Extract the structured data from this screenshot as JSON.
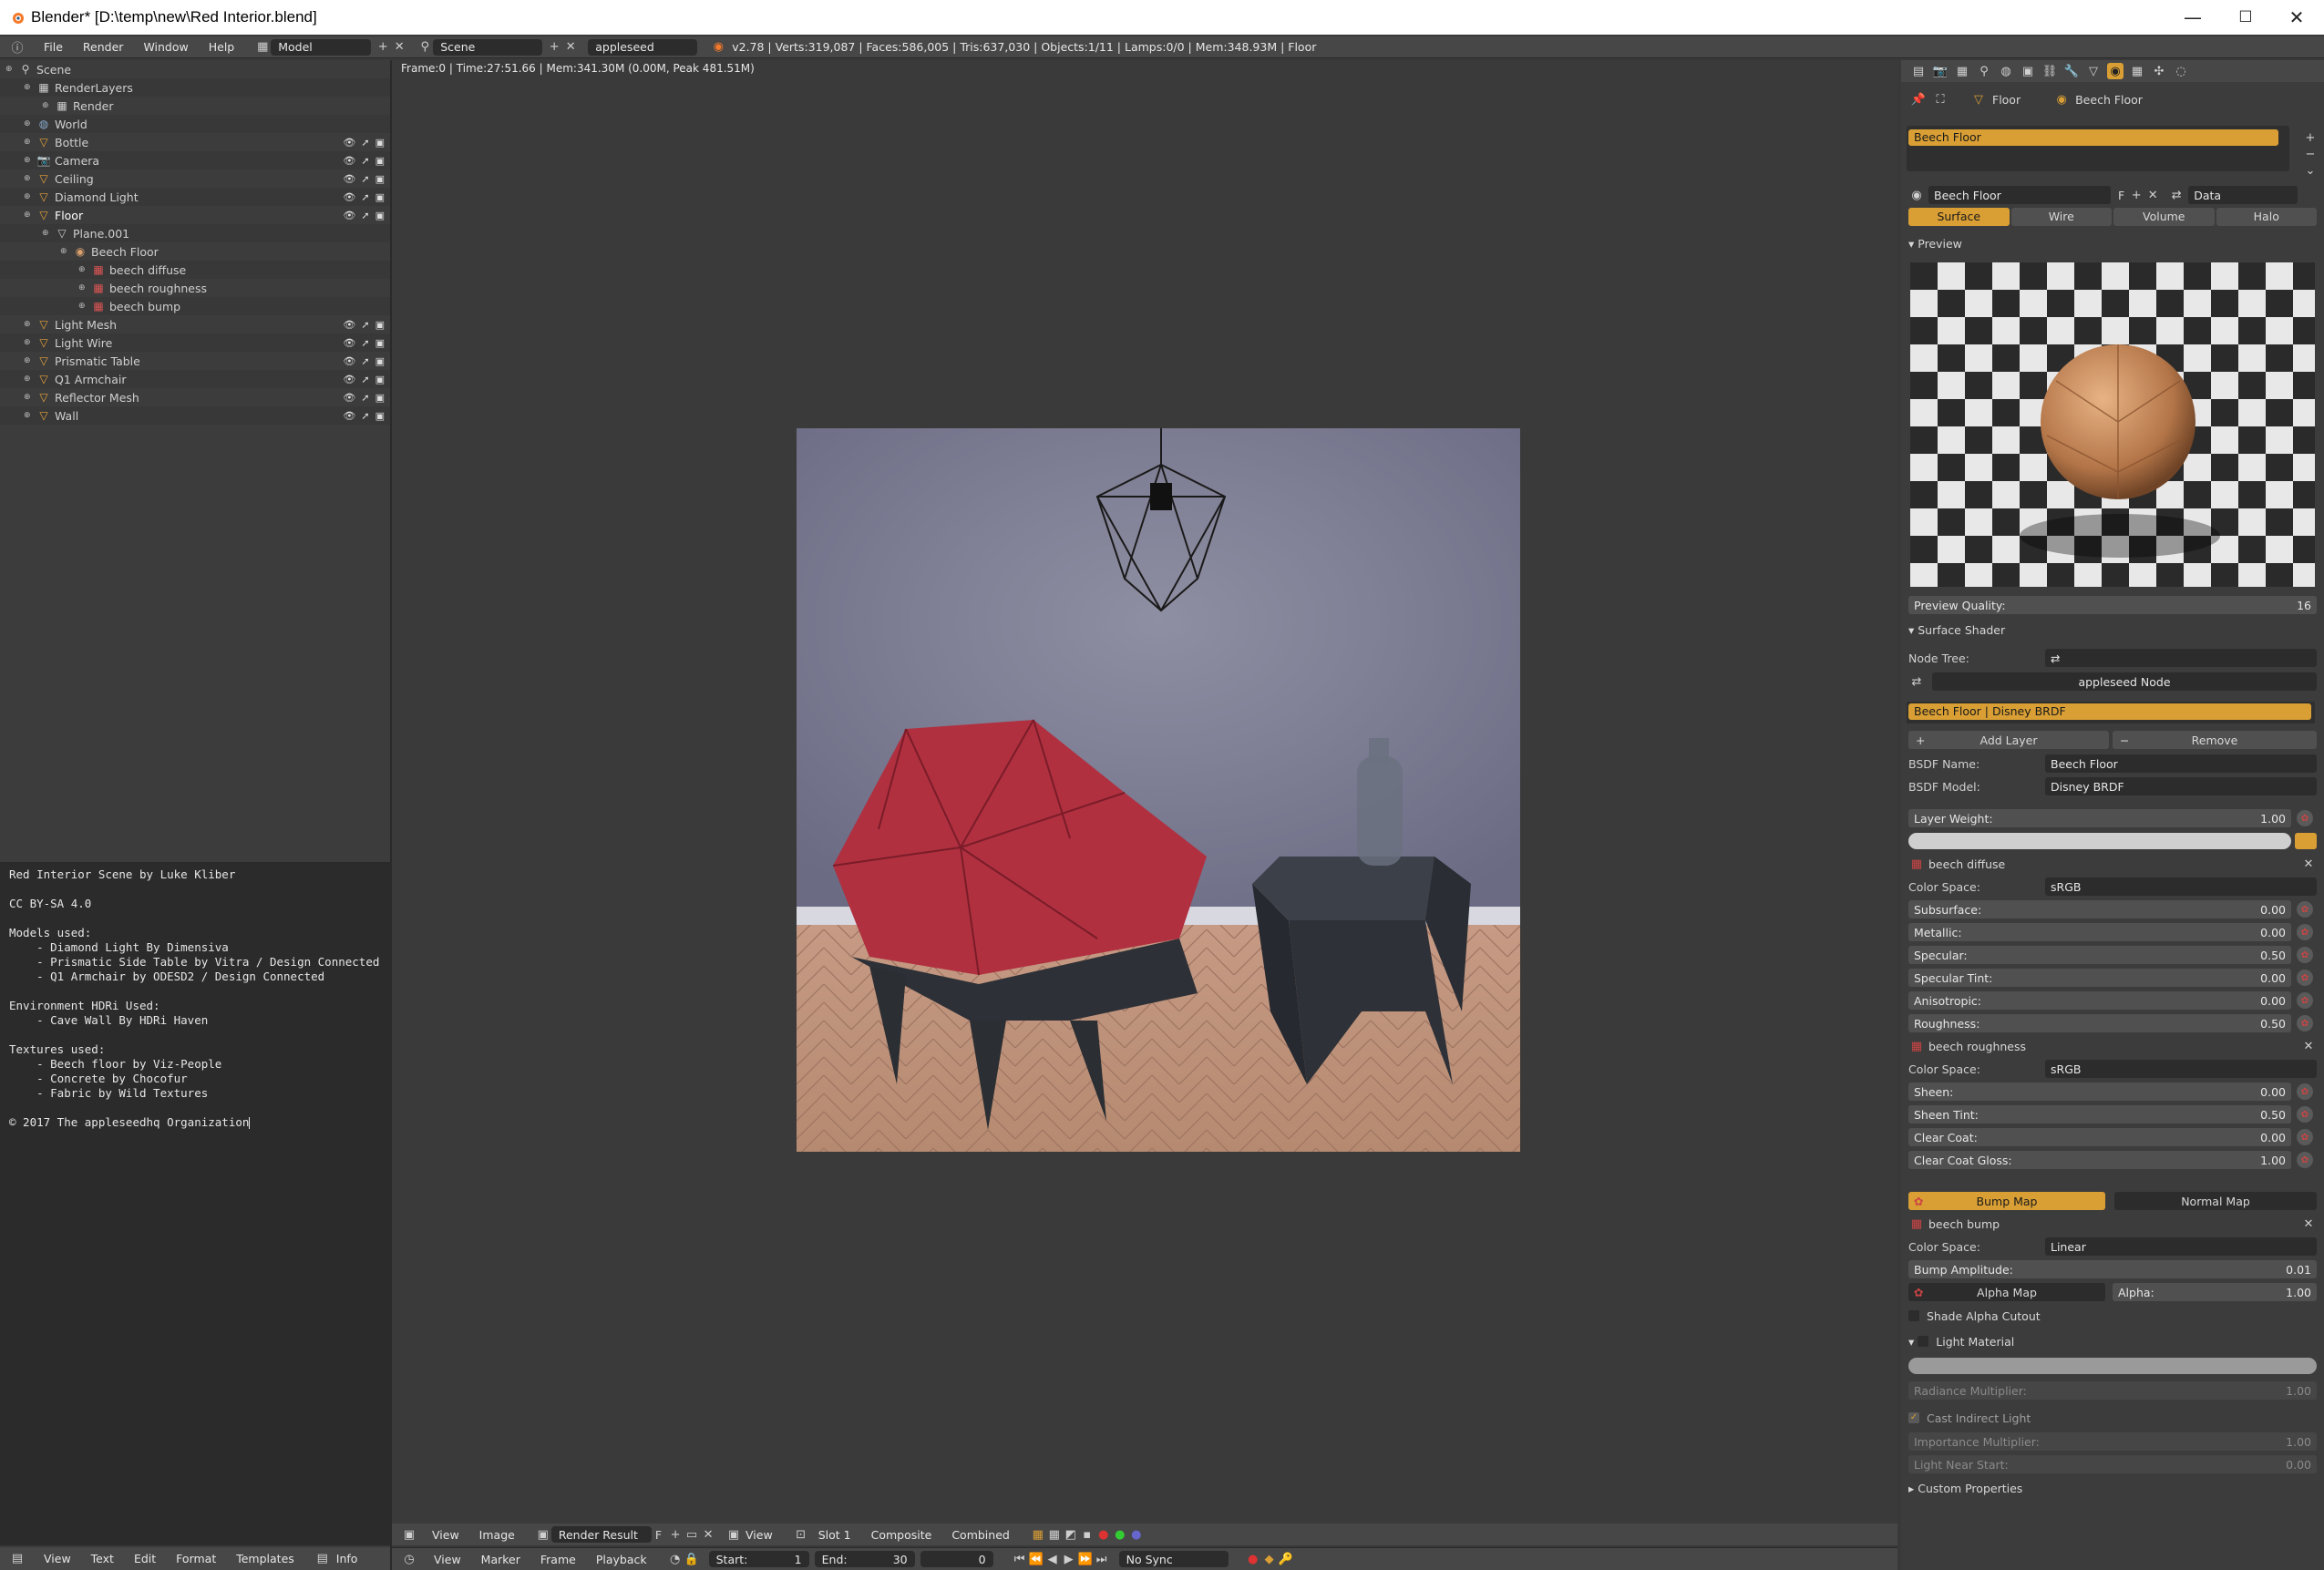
{
  "window": {
    "title": "Blender* [D:\\temp\\new\\Red Interior.blend]",
    "minimize": "—",
    "maximize": "☐",
    "close": "✕"
  },
  "info_header": {
    "menus": [
      "File",
      "Render",
      "Window",
      "Help"
    ],
    "screen_layout": "Model",
    "scene": "Scene",
    "render_engine": "appleseed",
    "stats": "v2.78 | Verts:319,087 | Faces:586,005 | Tris:637,030 | Objects:1/11 | Lamps:0/0 | Mem:348.93M | Floor"
  },
  "outliner": {
    "rows": [
      {
        "label": "Scene",
        "icon": "scene-icon",
        "indent": 0,
        "vis": false
      },
      {
        "label": "RenderLayers",
        "icon": "renderlayers-icon",
        "indent": 1,
        "vis": false
      },
      {
        "label": "Render",
        "icon": "renderlayer-icon",
        "indent": 2,
        "vis": false
      },
      {
        "label": "World",
        "icon": "world-icon",
        "indent": 1,
        "vis": false
      },
      {
        "label": "Bottle",
        "icon": "mesh-icon",
        "indent": 1,
        "vis": true
      },
      {
        "label": "Camera",
        "icon": "camera-icon",
        "indent": 1,
        "vis": true
      },
      {
        "label": "Ceiling",
        "icon": "mesh-icon",
        "indent": 1,
        "vis": true
      },
      {
        "label": "Diamond Light",
        "icon": "mesh-icon",
        "indent": 1,
        "vis": true
      },
      {
        "label": "Floor",
        "icon": "mesh-icon",
        "indent": 1,
        "vis": true,
        "selected": true
      },
      {
        "label": "Plane.001",
        "icon": "meshdata-icon",
        "indent": 2,
        "vis": false
      },
      {
        "label": "Beech Floor",
        "icon": "material-icon",
        "indent": 3,
        "vis": false
      },
      {
        "label": "beech diffuse",
        "icon": "texture-icon",
        "indent": 4,
        "vis": false
      },
      {
        "label": "beech roughness",
        "icon": "texture-icon",
        "indent": 4,
        "vis": false
      },
      {
        "label": "beech bump",
        "icon": "texture-icon",
        "indent": 4,
        "vis": false
      },
      {
        "label": "Light Mesh",
        "icon": "mesh-icon",
        "indent": 1,
        "vis": true
      },
      {
        "label": "Light Wire",
        "icon": "mesh-icon",
        "indent": 1,
        "vis": true
      },
      {
        "label": "Prismatic Table",
        "icon": "mesh-icon",
        "indent": 1,
        "vis": true
      },
      {
        "label": "Q1 Armchair",
        "icon": "mesh-icon",
        "indent": 1,
        "vis": true
      },
      {
        "label": "Reflector Mesh",
        "icon": "mesh-icon",
        "indent": 1,
        "vis": true
      },
      {
        "label": "Wall",
        "icon": "mesh-icon",
        "indent": 1,
        "vis": true
      }
    ]
  },
  "text_editor": {
    "content": "Red Interior Scene by Luke Kliber\n\nCC BY-SA 4.0\n\nModels used:\n    - Diamond Light By Dimensiva\n    - Prismatic Side Table by Vitra / Design Connected\n    - Q1 Armchair by ODESD2 / Design Connected\n\nEnvironment HDRi Used:\n    - Cave Wall By HDRi Haven\n\nTextures used:\n    - Beech floor by Viz-People\n    - Concrete by Chocofur\n    - Fabric by Wild Textures\n\n© 2017 The appleseedhq Organization",
    "footer_menus": [
      "View",
      "Text",
      "Edit",
      "Format",
      "Templates"
    ],
    "footer_info": "Info"
  },
  "image_editor": {
    "status": "Frame:0 | Time:27:51.66 | Mem:341.30M (0.00M, Peak 481.51M)",
    "footer": {
      "view": "View",
      "image": "Image",
      "image_name": "Render Result",
      "fake": "F",
      "view2": "View",
      "slot": "Slot 1",
      "layer": "Composite",
      "pass": "Combined"
    }
  },
  "timeline": {
    "menus": [
      "View",
      "Marker",
      "Frame",
      "Playback"
    ],
    "start_label": "Start:",
    "start_value": "1",
    "end_label": "End:",
    "end_value": "30",
    "current": "0",
    "sync": "No Sync"
  },
  "properties": {
    "breadcrumb": [
      "Floor",
      "Beech Floor"
    ],
    "slot_name": "Beech Floor",
    "material_name": "Beech Floor",
    "material_fake": "F",
    "link_mode": "Data",
    "tabs": [
      "Surface",
      "Wire",
      "Volume",
      "Halo"
    ],
    "preview_header": "Preview",
    "preview_quality_label": "Preview Quality:",
    "preview_quality": "16",
    "surface_shader_header": "Surface Shader",
    "node_tree_label": "Node Tree:",
    "node_name": "appleseed Node",
    "layer_item": "Beech Floor  |  Disney BRDF",
    "add_layer": "Add Layer",
    "remove": "Remove",
    "bsdf_name_label": "BSDF Name:",
    "bsdf_name": "Beech Floor",
    "bsdf_model_label": "BSDF Model:",
    "bsdf_model": "Disney BRDF",
    "layer_weight_label": "Layer Weight:",
    "layer_weight": "1.00",
    "tex1_name": "beech diffuse",
    "color_space_label": "Color Space:",
    "tex1_colorspace": "sRGB",
    "params1": [
      {
        "label": "Subsurface:",
        "value": "0.00"
      },
      {
        "label": "Metallic:",
        "value": "0.00"
      },
      {
        "label": "Specular:",
        "value": "0.50"
      },
      {
        "label": "Specular Tint:",
        "value": "0.00"
      },
      {
        "label": "Anisotropic:",
        "value": "0.00"
      },
      {
        "label": "Roughness:",
        "value": "0.50"
      }
    ],
    "tex2_name": "beech roughness",
    "tex2_colorspace": "sRGB",
    "params2": [
      {
        "label": "Sheen:",
        "value": "0.00"
      },
      {
        "label": "Sheen Tint:",
        "value": "0.50"
      },
      {
        "label": "Clear Coat:",
        "value": "0.00"
      },
      {
        "label": "Clear Coat Gloss:",
        "value": "1.00"
      }
    ],
    "bump_map": "Bump Map",
    "normal_map": "Normal Map",
    "tex3_name": "beech bump",
    "tex3_colorspace": "Linear",
    "bump_amplitude_label": "Bump Amplitude:",
    "bump_amplitude": "0.01",
    "alpha_map": "Alpha Map",
    "alpha_label": "Alpha:",
    "alpha": "1.00",
    "shade_alpha_cutout": "Shade Alpha Cutout",
    "light_material": "Light Material",
    "radiance_multiplier_label": "Radiance Multiplier:",
    "radiance_multiplier": "1.00",
    "cast_indirect_light": "Cast Indirect Light",
    "importance_multiplier_label": "Importance Multiplier:",
    "importance_multiplier": "1.00",
    "light_near_start_label": "Light Near Start:",
    "light_near_start": "0.00",
    "custom_properties": "Custom Properties"
  },
  "colors": {
    "accent": "#d99f34",
    "panel": "#3c3c3c",
    "header": "#474747",
    "field": "#2c2c2c"
  }
}
